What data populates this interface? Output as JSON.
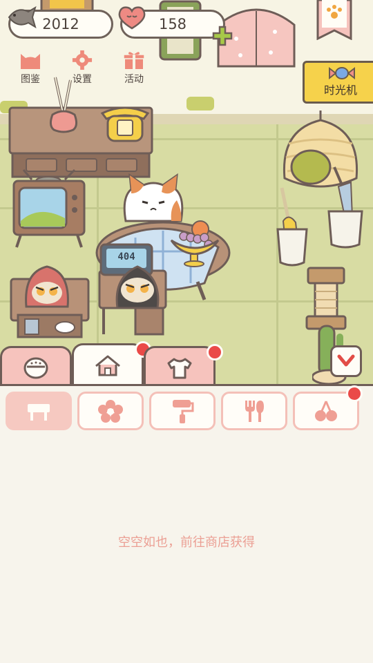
{
  "hud": {
    "coins": "2012",
    "hearts": "158"
  },
  "top_menu": [
    {
      "label": "图鉴",
      "icon": "cat-face-icon"
    },
    {
      "label": "设置",
      "icon": "gear-icon"
    },
    {
      "label": "活动",
      "icon": "gift-icon"
    }
  ],
  "time_machine": {
    "label": "时光机"
  },
  "tv_screen": {
    "text": "404"
  },
  "tabs": [
    {
      "icon": "cat-food-bowl-icon",
      "active": false,
      "badge": false
    },
    {
      "icon": "house-icon",
      "active": true,
      "badge": true
    },
    {
      "icon": "shirt-icon",
      "active": false,
      "badge": true
    }
  ],
  "categories": [
    {
      "icon": "table-icon",
      "active": true,
      "badge": false
    },
    {
      "icon": "flower-icon",
      "active": false,
      "badge": false
    },
    {
      "icon": "paint-roller-icon",
      "active": false,
      "badge": false
    },
    {
      "icon": "utensils-icon",
      "active": false,
      "badge": false
    },
    {
      "icon": "cherry-icon",
      "active": false,
      "badge": true
    }
  ],
  "empty_state": {
    "text": "空空如也，前往商店获得"
  },
  "colors": {
    "accent_pink": "#f6c3bd",
    "badge_red": "#ea4a48",
    "outline": "#6e5d57",
    "empty_text": "#eb9f94"
  }
}
